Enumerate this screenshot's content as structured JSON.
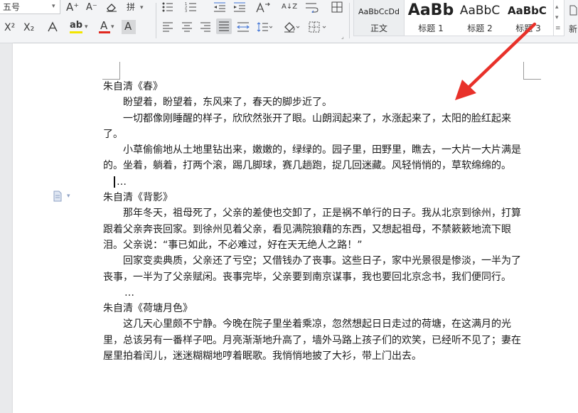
{
  "ribbon": {
    "font_size": "五号",
    "increase_font_glyph": "A⁺",
    "decrease_font_glyph": "A⁻",
    "pinyin_glyph": "拼",
    "superscript_glyph": "X²",
    "subscript_glyph": "X₂",
    "font_color_glyph": "A",
    "char_shading_glyph": "A",
    "highlight_glyph": "ab",
    "sort_glyph": "A↓Z",
    "accent_color": "#3b6fd4",
    "highlight_color": "#f2e500",
    "font_color": "#e0281e"
  },
  "styles": [
    {
      "sample": "AaBbCcDd",
      "label": "正文"
    },
    {
      "sample": "AaBb",
      "label": "标题 1"
    },
    {
      "sample": "AaBbC",
      "label": "标题 2"
    },
    {
      "sample": "AaBbC",
      "label": "标题 3"
    }
  ],
  "new_style_partial": "新",
  "annotation_arrow_color": "#e8312a",
  "document": {
    "paragraphs": [
      {
        "text": "朱自清《春》",
        "indent": false
      },
      {
        "text": "盼望着，盼望着，东风来了，春天的脚步近了。",
        "indent": true
      },
      {
        "text": "一切都像刚睡醒的样子，欣欣然张开了眼。山朗润起来了，水涨起来了，太阳的脸红起来了。",
        "indent": true
      },
      {
        "text": "小草偷偷地从土地里钻出来，嫩嫩的，绿绿的。园子里，田野里，瞧去，一大片一大片满是的。坐着，躺着，打两个滚，踢几脚球，赛几趟跑，捉几回迷藏。风轻悄悄的，草软绵绵的。",
        "indent": true
      },
      {
        "text": "…",
        "indent": false,
        "ellipsis": true,
        "cursor": true
      },
      {
        "text": "朱自清《背影》",
        "indent": false
      },
      {
        "text": "那年冬天，祖母死了，父亲的差使也交卸了，正是祸不单行的日子。我从北京到徐州，打算跟着父亲奔丧回家。到徐州见着父亲，看见满院狼藉的东西，又想起祖母，不禁簌簌地流下眼泪。父亲说：“事已如此，不必难过，好在天无绝人之路！”",
        "indent": true
      },
      {
        "text": "回家变卖典质，父亲还了亏空；又借钱办了丧事。这些日子，家中光景很是惨淡，一半为了丧事，一半为了父亲赋闲。丧事完毕，父亲要到南京谋事，我也要回北京念书，我们便同行。",
        "indent": true
      },
      {
        "text": "…",
        "indent": false,
        "ellipsis": true,
        "cursor": false
      },
      {
        "text": "朱自清《荷塘月色》",
        "indent": false
      },
      {
        "text": "这几天心里颇不宁静。今晚在院子里坐着乘凉，忽然想起日日走过的荷塘，在这满月的光里，总该另有一番样子吧。月亮渐渐地升高了，墙外马路上孩子们的欢笑，已经听不见了；妻在屋里拍着闰儿，迷迷糊糊地哼着眠歌。我悄悄地披了大衫，带上门出去。",
        "indent": true
      }
    ]
  }
}
